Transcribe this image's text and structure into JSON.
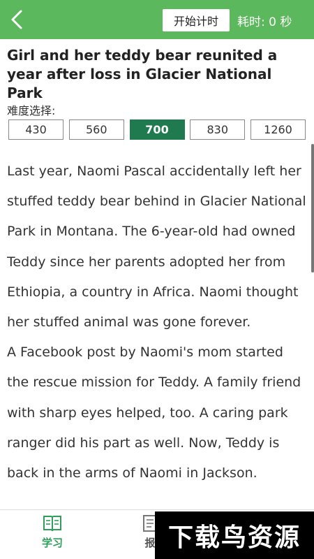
{
  "header": {
    "back_icon": "chevron-left-icon",
    "start_timer_label": "开始计时",
    "elapsed_label": "耗时: 0 秒",
    "bar_color": "#5cb85c"
  },
  "article": {
    "title": "Girl and her teddy bear reunited a year after loss in Glacier National Park",
    "difficulty_label": "难度选择:",
    "levels": [
      "430",
      "560",
      "700",
      "830",
      "1260"
    ],
    "selected_level": "700",
    "paragraphs": [
      "Last year, Naomi Pascal accidentally left her stuffed teddy bear behind in Glacier National Park in Montana. The 6-year-old had owned Teddy since her parents adopted her from Ethiopia, a country in Africa. Naomi thought her stuffed animal was gone forever.",
      "A Facebook post by Naomi's mom started the rescue mission for Teddy. A family friend with sharp eyes helped, too. A caring park ranger did his part as well. Now, Teddy is back in the arms of Naomi in Jackson."
    ]
  },
  "bottom_nav": {
    "tabs": [
      {
        "label": "学习",
        "icon": "book-icon",
        "active": true
      },
      {
        "label": "报",
        "icon": "report-icon",
        "active": false
      }
    ]
  },
  "watermark": {
    "text": "下载鸟资源"
  },
  "colors": {
    "accent": "#2f9e5a",
    "selected_level_bg": "#1f7a4f"
  }
}
